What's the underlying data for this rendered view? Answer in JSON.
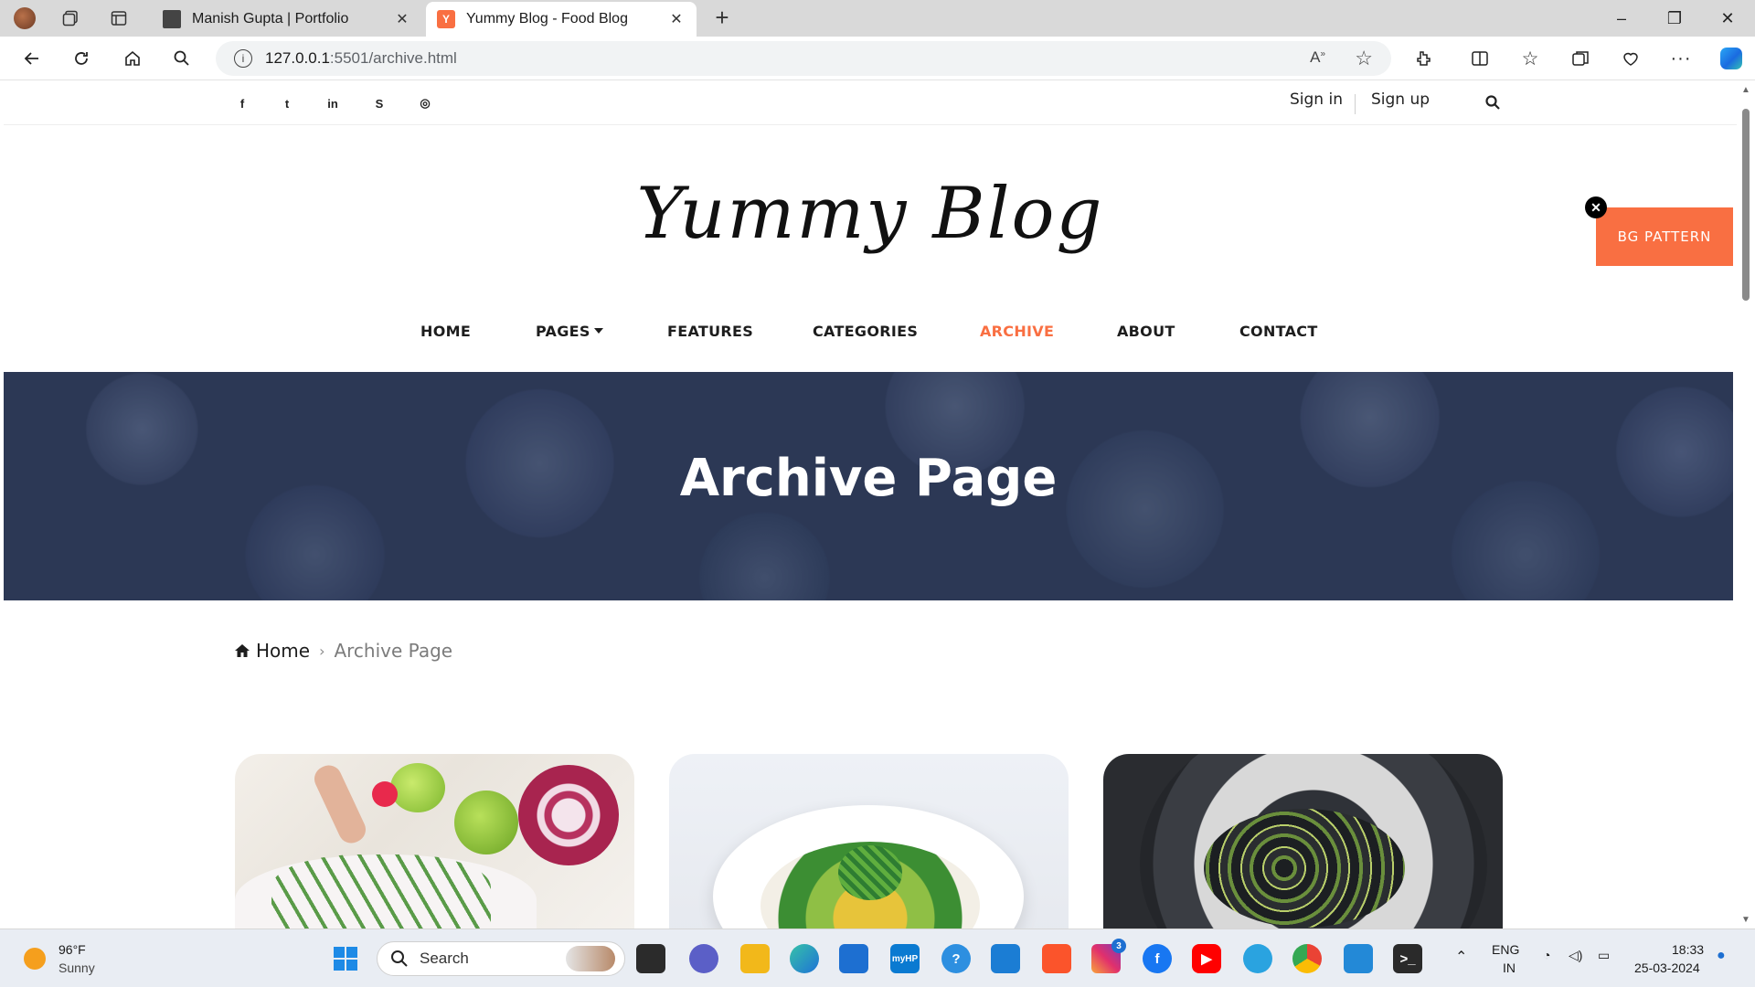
{
  "browser": {
    "tabs": [
      {
        "title": "Manish Gupta | Portfolio",
        "active": false
      },
      {
        "title": "Yummy Blog - Food Blog",
        "active": true
      }
    ],
    "new_tab": "+",
    "url_host": "127.0.0.1",
    "url_rest": ":5501/archive.html",
    "window_controls": {
      "minimize": "–",
      "restore": "❐",
      "close": "✕"
    }
  },
  "site": {
    "social_icons": [
      "facebook-icon",
      "twitter-icon",
      "linkedin-icon",
      "skype-icon",
      "dribbble-icon"
    ],
    "social_glyphs": {
      "facebook": "f",
      "twitter": "t",
      "linkedin": "in",
      "skype": "S",
      "dribbble": "◎"
    },
    "sign_in": "Sign in",
    "sign_up": "Sign up",
    "logo": "Yummy Blog",
    "bg_pattern": "BG PATTERN",
    "bg_pattern_close": "✕",
    "accent_color": "#f96f42",
    "nav": {
      "home": "HOME",
      "pages": "PAGES",
      "features": "FEATURES",
      "categories": "CATEGORIES",
      "archive": "ARCHIVE",
      "about": "ABOUT",
      "contact": "CONTACT",
      "active": "ARCHIVE"
    },
    "hero_title": "Archive Page",
    "breadcrumb": {
      "home": "Home",
      "separator": "›",
      "current": "Archive Page"
    }
  },
  "taskbar": {
    "weather_temp": "96°F",
    "weather_desc": "Sunny",
    "search_placeholder": "Search",
    "instagram_badge": "3",
    "lang_top": "ENG",
    "lang_bottom": "IN",
    "time": "18:33",
    "date": "25-03-2024"
  }
}
